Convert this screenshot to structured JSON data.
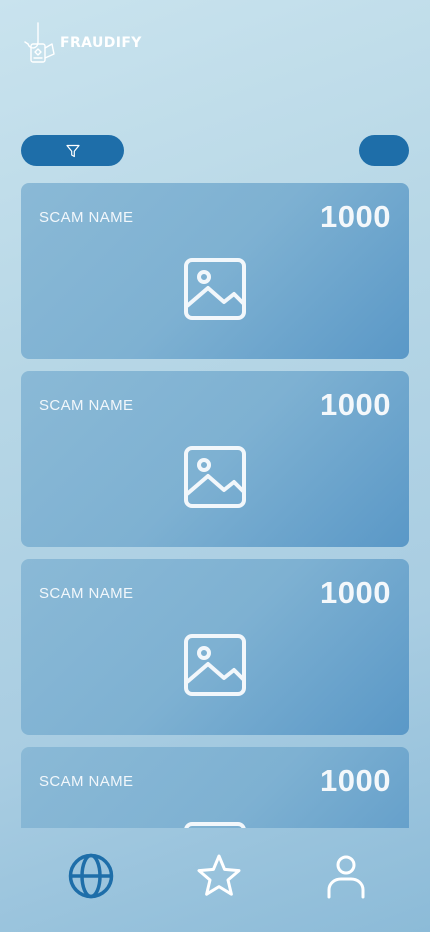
{
  "app": {
    "brand": "FRAUDIFY",
    "accent_color": "#1e6ea9"
  },
  "toolbar": {
    "filter_icon": "filter-icon",
    "sort_button": ""
  },
  "cards": [
    {
      "name": "SCAM NAME",
      "count": "1000",
      "image_icon": "image-placeholder-icon"
    },
    {
      "name": "SCAM NAME",
      "count": "1000",
      "image_icon": "image-placeholder-icon"
    },
    {
      "name": "SCAM NAME",
      "count": "1000",
      "image_icon": "image-placeholder-icon"
    },
    {
      "name": "SCAM NAME",
      "count": "1000",
      "image_icon": "image-placeholder-icon"
    }
  ],
  "nav": {
    "items": [
      {
        "icon": "globe-icon",
        "active": true
      },
      {
        "icon": "star-icon",
        "active": false
      },
      {
        "icon": "user-icon",
        "active": false
      }
    ]
  }
}
